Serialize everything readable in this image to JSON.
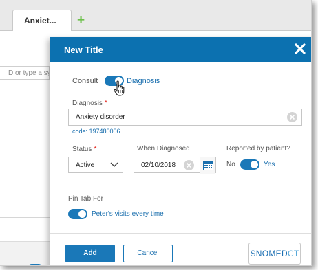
{
  "tabs": [
    {
      "label": "Anxiet..."
    }
  ],
  "background": {
    "search_placeholder": "D or type a sy"
  },
  "modal": {
    "title": "New Title",
    "consult_label": "Consult",
    "diagnosis_toggle_label": "Diagnosis",
    "diagnosis_field_label": "Diagnosis",
    "diagnosis_value": "Anxiety disorder",
    "code_text": "code: 197480006",
    "status_label": "Status",
    "status_value": "Active",
    "when_label": "When Diagnosed",
    "when_value": "02/10/2018",
    "reported_label": "Reported by patient?",
    "reported_no": "No",
    "reported_yes": "Yes",
    "pin_label": "Pin Tab For",
    "pin_option": "Peter's visits every time",
    "add_button": "Add",
    "cancel_button": "Cancel",
    "snomed_a": "SNOMED",
    "snomed_b": "CT",
    "required_mark": "*"
  },
  "icons": {
    "close": "close-icon",
    "add_tab": "plus-icon",
    "calendar": "calendar-icon",
    "clear": "clear-icon",
    "chevron": "chevron-down-icon",
    "cursor": "hand-pointer-icon"
  },
  "colors": {
    "accent": "#0c71b0",
    "toggle": "#1a78b8",
    "add_tab": "#6cc04a",
    "required": "#e2231a"
  }
}
